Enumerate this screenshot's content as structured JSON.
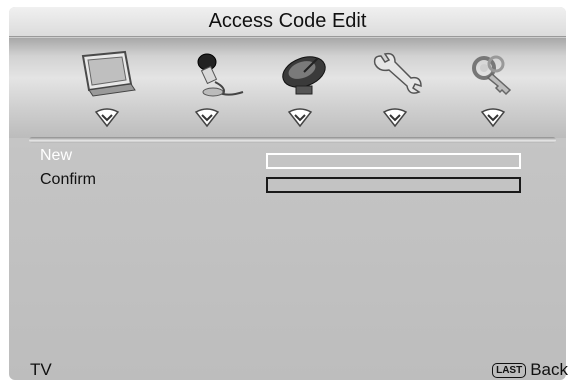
{
  "title": "Access Code Edit",
  "menu_icons": [
    {
      "name": "picture-icon"
    },
    {
      "name": "audio-icon"
    },
    {
      "name": "channel-icon"
    },
    {
      "name": "setup-icon"
    },
    {
      "name": "lock-icon"
    }
  ],
  "form": {
    "new_label": "New",
    "confirm_label": "Confirm",
    "new_value": "",
    "confirm_value": ""
  },
  "footer": {
    "source": "TV",
    "last_key": "LAST",
    "back_label": "Back"
  },
  "colors": {
    "selected_row_text": "#ffffff",
    "normal_text": "#111111",
    "background": "#c4c4c4"
  }
}
